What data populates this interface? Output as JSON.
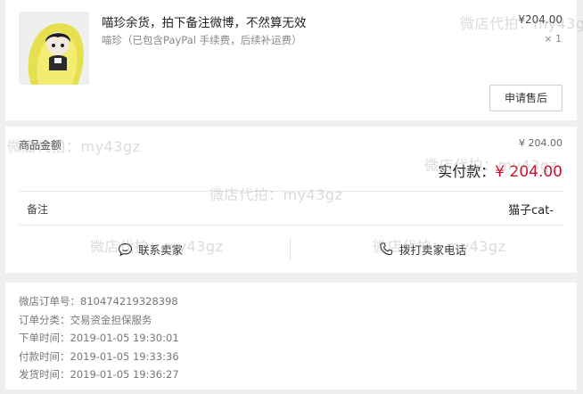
{
  "product": {
    "title": "喵珍余货，拍下备注微博，不然算无效",
    "subtitle": "喵珍（已包含PayPal 手续费，后续补运费）",
    "price": "¥204.00",
    "quantity": "× 1",
    "refund_button": "申请售后"
  },
  "amount": {
    "goods_label": "商品金额",
    "goods_value": "¥ 204.00",
    "paid_label": "实付款：",
    "paid_value": "¥ 204.00",
    "note_label": "备注",
    "note_value": "猫子cat-",
    "contact_seller": "联系卖家",
    "call_seller": "拨打卖家电话"
  },
  "order_info": {
    "lines": [
      "微店订单号：810474219328398",
      "订单分类：交易资金担保服务",
      "下单时间：2019-01-05 19:30:01",
      "付款时间：2019-01-05 19:33:36",
      "发货时间：2019-01-05 19:36:27"
    ]
  },
  "watermarks": {
    "w1": "微店代拍：my43gz",
    "w2": "微店代拍：my43gz",
    "w3": "微店代拍：my43gz",
    "w4": "微店代拍：my43gz",
    "w5": "微店代拍：my43gz",
    "w6": "微店代拍：my43gz"
  },
  "colors": {
    "accent_red": "#c8102e",
    "page_bg": "#efefef"
  },
  "icons": {
    "contact": "chat-bubble-icon",
    "call": "phone-icon"
  }
}
